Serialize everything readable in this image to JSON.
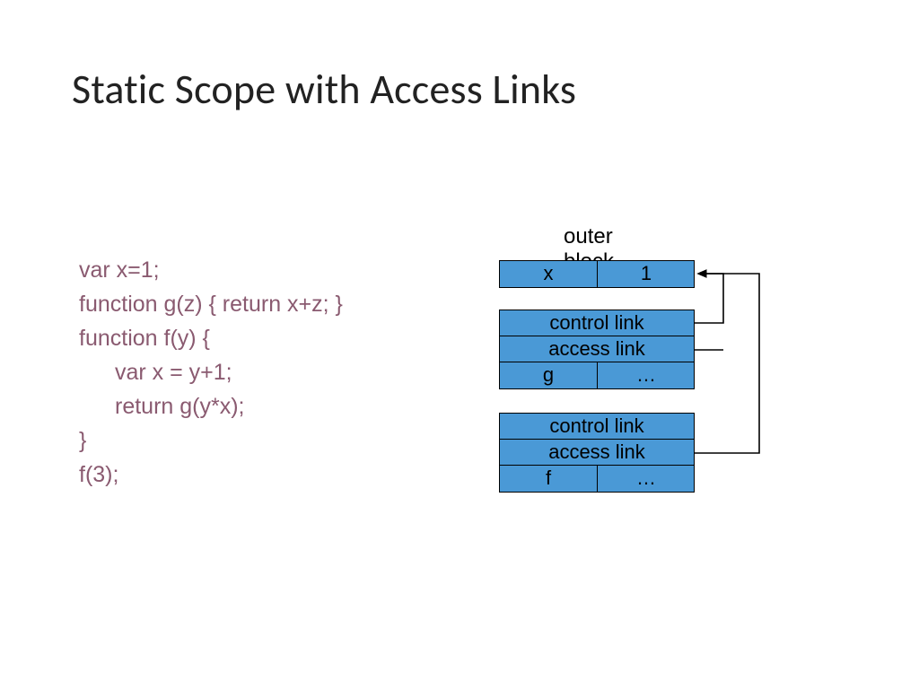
{
  "title": "Static Scope with Access Links",
  "code": {
    "l1": "var x=1;",
    "l2": "function g(z) { return x+z; }",
    "l3": "function f(y) {",
    "l4": "var x = y+1;",
    "l5": "return g(y*x);",
    "l6": "}",
    "l7": "f(3);"
  },
  "diagram": {
    "outer_label": "outer block",
    "frame1": {
      "var": "x",
      "val": "1"
    },
    "frame2": {
      "control": "control link",
      "access": "access link",
      "var": "g",
      "val": "…"
    },
    "frame3": {
      "control": "control link",
      "access": "access link",
      "var": "f",
      "val": "…"
    }
  }
}
